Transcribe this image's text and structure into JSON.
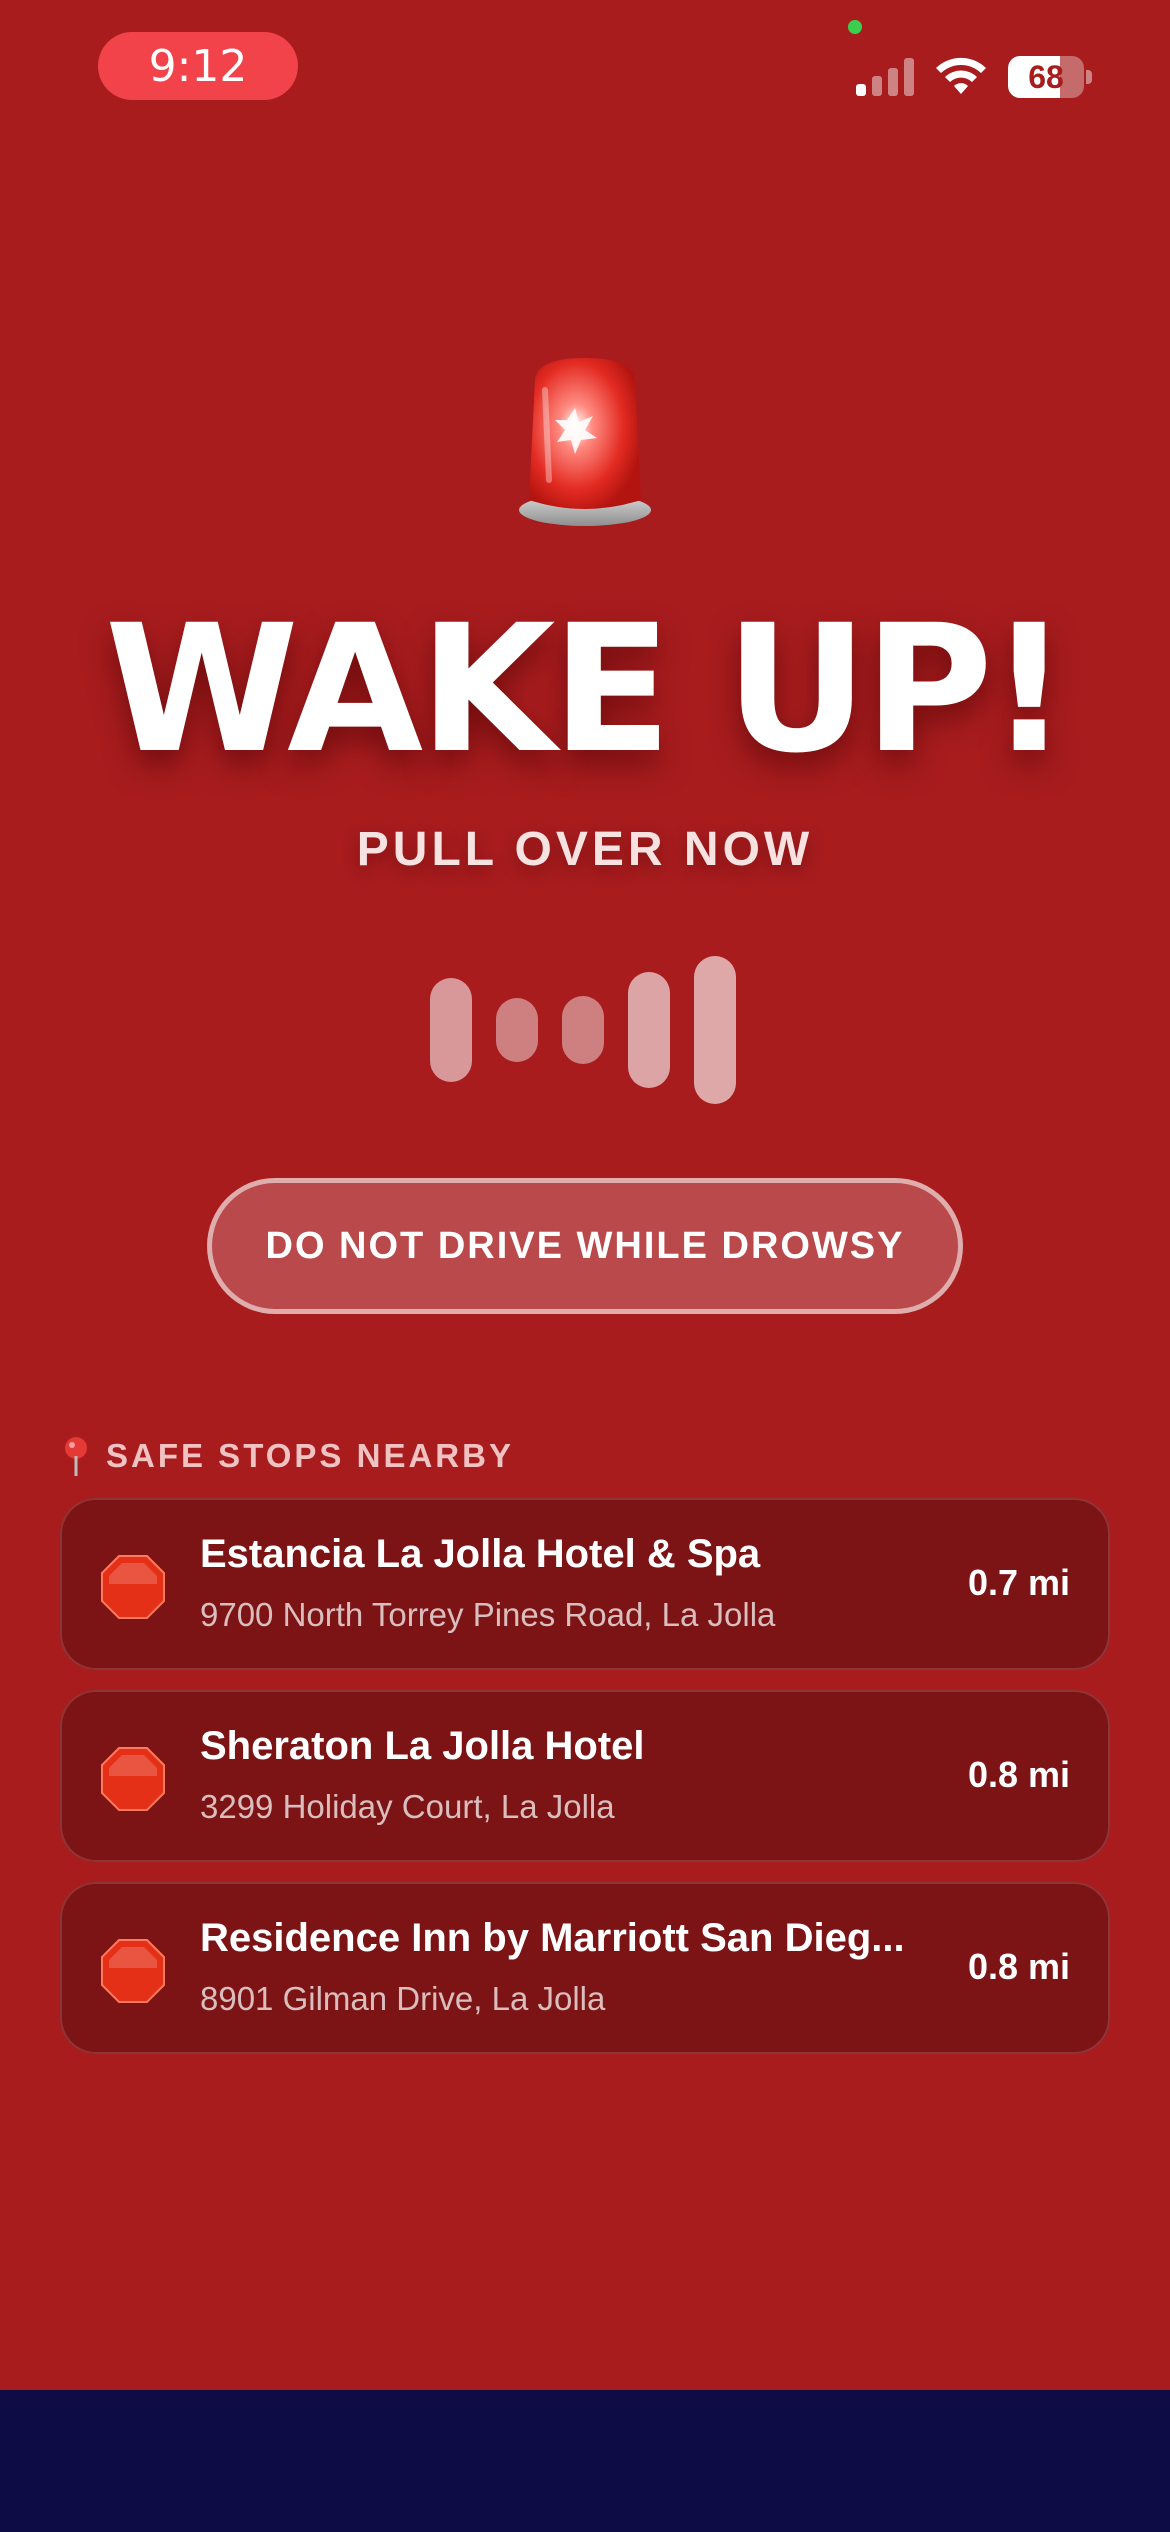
{
  "status_bar": {
    "time": "9:12",
    "battery_level": "68",
    "battery_fraction": 0.68,
    "signal_bars_active": 1,
    "signal_bars_total": 4
  },
  "alert": {
    "icon": "siren-icon",
    "headline": "WAKE UP!",
    "subhead": "PULL OVER NOW",
    "warning": "DO NOT DRIVE WHILE DROWSY"
  },
  "stops_section": {
    "header_icon": "pin-icon",
    "title": "SAFE STOPS NEARBY",
    "items": [
      {
        "icon": "stop-sign-icon",
        "name": "Estancia La Jolla Hotel & Spa",
        "address": "9700 North Torrey Pines Road, La Jolla",
        "distance": "0.7 mi"
      },
      {
        "icon": "stop-sign-icon",
        "name": "Sheraton La Jolla Hotel",
        "address": "3299 Holiday Court, La Jolla",
        "distance": "0.8 mi"
      },
      {
        "icon": "stop-sign-icon",
        "name": "Residence Inn by Marriott San Dieg...",
        "address": "8901 Gilman Drive, La Jolla",
        "distance": "0.8 mi"
      }
    ]
  },
  "colors": {
    "background": "#a81c1e",
    "card": "#7c1315",
    "time_pill": "#f2434a",
    "bottom_bar": "#0e0c44"
  }
}
